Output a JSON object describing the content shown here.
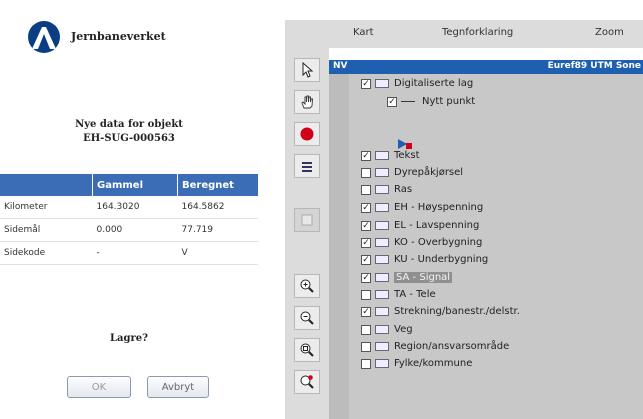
{
  "brand": {
    "name": "Jernbaneverket"
  },
  "dialog": {
    "heading_line1": "Nye data for objekt",
    "heading_line2": "EH-SUG-000563",
    "table": {
      "headers": [
        "",
        "Gammel",
        "Beregnet"
      ],
      "rows": [
        {
          "label": "Kilometer",
          "old": "164.3020",
          "new": "164.5862"
        },
        {
          "label": "Sidemål",
          "old": "0.000",
          "new": "77.719"
        },
        {
          "label": "Sidekode",
          "old": "-",
          "new": "V"
        }
      ]
    },
    "prompt": "Lagre?",
    "ok_label": "OK",
    "cancel_label": "Avbryt"
  },
  "menubar": {
    "items": [
      "Kart",
      "Tegnforklaring",
      "Zoom"
    ]
  },
  "tools": [
    "select-arrow-icon",
    "pan-hand-icon",
    "record-dot-icon",
    "layer-list-icon",
    "blank-tool-icon",
    "zoom-in-icon",
    "zoom-out-icon",
    "zoom-extent-icon",
    "zoom-select-icon"
  ],
  "legend": {
    "ruler_label": "NV",
    "coord_system": "Euref89 UTM Sone",
    "layers": [
      {
        "label": "Digitaliserte lag",
        "checked": true,
        "kind": "folder",
        "level": 0
      },
      {
        "label": "Nytt punkt",
        "checked": true,
        "kind": "line",
        "level": 1
      },
      {
        "label": "Tekst",
        "checked": true,
        "kind": "folder",
        "level": 0
      },
      {
        "label": "Dyrepåkjørsel",
        "checked": false,
        "kind": "folder",
        "level": 0
      },
      {
        "label": "Ras",
        "checked": false,
        "kind": "folder",
        "level": 0
      },
      {
        "label": "EH - Høyspenning",
        "checked": true,
        "kind": "folder",
        "level": 0
      },
      {
        "label": "EL - Lavspenning",
        "checked": true,
        "kind": "folder",
        "level": 0
      },
      {
        "label": "KO - Overbygning",
        "checked": true,
        "kind": "folder",
        "level": 0
      },
      {
        "label": "KU - Underbygning",
        "checked": true,
        "kind": "folder",
        "level": 0
      },
      {
        "label": "SA - Signal",
        "checked": true,
        "kind": "folder",
        "level": 0,
        "highlighted": true
      },
      {
        "label": "TA - Tele",
        "checked": false,
        "kind": "folder",
        "level": 0
      },
      {
        "label": "Strekning/banestr./delstr.",
        "checked": true,
        "kind": "folder",
        "level": 0
      },
      {
        "label": "Veg",
        "checked": false,
        "kind": "folder",
        "level": 0
      },
      {
        "label": "Region/ansvarsområde",
        "checked": false,
        "kind": "folder",
        "level": 0
      },
      {
        "label": "Fylke/kommune",
        "checked": false,
        "kind": "folder",
        "level": 0
      }
    ]
  },
  "colors": {
    "accent": "#1f5fb0",
    "table_header": "#3a6db5",
    "record": "#d0001a"
  }
}
